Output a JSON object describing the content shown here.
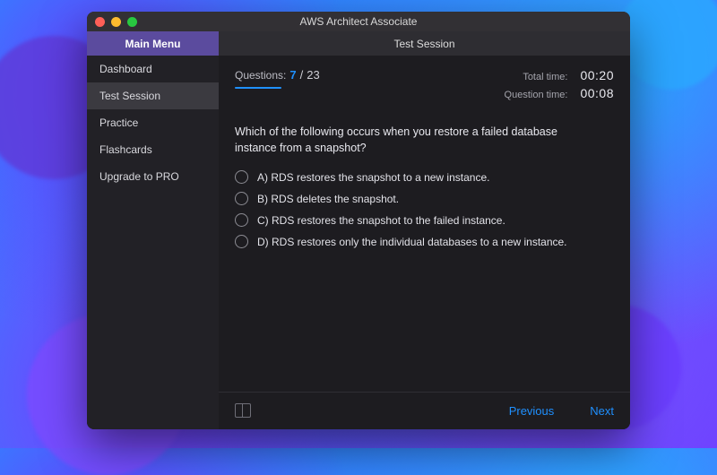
{
  "window": {
    "title": "AWS Architect Associate"
  },
  "sidebar": {
    "header": "Main Menu",
    "items": [
      {
        "label": "Dashboard",
        "active": false
      },
      {
        "label": "Test Session",
        "active": true
      },
      {
        "label": "Practice",
        "active": false
      },
      {
        "label": "Flashcards",
        "active": false
      },
      {
        "label": "Upgrade to PRO",
        "active": false
      }
    ]
  },
  "main": {
    "header": "Test Session",
    "stats": {
      "questions_label": "Questions:",
      "current": "7",
      "separator": "/",
      "total": "23",
      "total_time_label": "Total time:",
      "total_time": "00:20",
      "question_time_label": "Question time:",
      "question_time": "00:08"
    },
    "question": {
      "text": "Which of the following occurs when you restore a failed database instance from a snapshot?",
      "answers": [
        "A) RDS restores the snapshot to a new instance.",
        "B) RDS deletes the snapshot.",
        "C) RDS restores the snapshot to the failed instance.",
        "D) RDS restores only the individual databases to a new instance."
      ]
    },
    "footer": {
      "previous": "Previous",
      "next": "Next"
    }
  }
}
